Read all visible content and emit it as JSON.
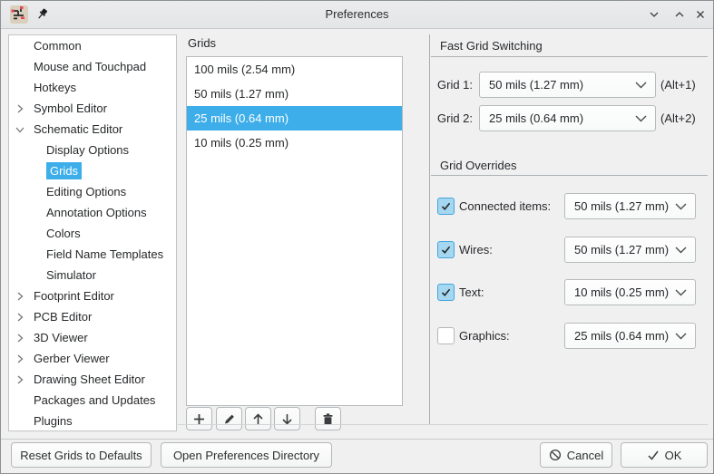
{
  "window": {
    "title": "Preferences",
    "icons": [
      "kicad-app-icon",
      "pin-icon",
      "minimize-icon",
      "maximize-icon",
      "close-icon"
    ]
  },
  "colors": {
    "accent": "#3daee9",
    "selection_text": "#ffffff",
    "panel_bg": "#f0f0f1",
    "sidebar_bg": "#ffffff"
  },
  "sidebar": {
    "items": [
      {
        "label": "Common",
        "level": 0,
        "expander": "none",
        "selected": false
      },
      {
        "label": "Mouse and Touchpad",
        "level": 0,
        "expander": "none",
        "selected": false
      },
      {
        "label": "Hotkeys",
        "level": 0,
        "expander": "none",
        "selected": false
      },
      {
        "label": "Symbol Editor",
        "level": 0,
        "expander": "collapsed",
        "selected": false
      },
      {
        "label": "Schematic Editor",
        "level": 0,
        "expander": "expanded",
        "selected": false
      },
      {
        "label": "Display Options",
        "level": 1,
        "expander": "none",
        "selected": false
      },
      {
        "label": "Grids",
        "level": 1,
        "expander": "none",
        "selected": true
      },
      {
        "label": "Editing Options",
        "level": 1,
        "expander": "none",
        "selected": false
      },
      {
        "label": "Annotation Options",
        "level": 1,
        "expander": "none",
        "selected": false
      },
      {
        "label": "Colors",
        "level": 1,
        "expander": "none",
        "selected": false
      },
      {
        "label": "Field Name Templates",
        "level": 1,
        "expander": "none",
        "selected": false
      },
      {
        "label": "Simulator",
        "level": 1,
        "expander": "none",
        "selected": false
      },
      {
        "label": "Footprint Editor",
        "level": 0,
        "expander": "collapsed",
        "selected": false
      },
      {
        "label": "PCB Editor",
        "level": 0,
        "expander": "collapsed",
        "selected": false
      },
      {
        "label": "3D Viewer",
        "level": 0,
        "expander": "collapsed",
        "selected": false
      },
      {
        "label": "Gerber Viewer",
        "level": 0,
        "expander": "collapsed",
        "selected": false
      },
      {
        "label": "Drawing Sheet Editor",
        "level": 0,
        "expander": "collapsed",
        "selected": false
      },
      {
        "label": "Packages and Updates",
        "level": 0,
        "expander": "none",
        "selected": false
      },
      {
        "label": "Plugins",
        "level": 0,
        "expander": "none",
        "selected": false
      }
    ]
  },
  "grids_panel": {
    "caption": "Grids",
    "items": [
      {
        "label": "100 mils (2.54 mm)",
        "selected": false
      },
      {
        "label": "50 mils (1.27 mm)",
        "selected": false
      },
      {
        "label": "25 mils (0.64 mm)",
        "selected": true
      },
      {
        "label": "10 mils (0.25 mm)",
        "selected": false
      }
    ],
    "toolbar_icons": [
      "add-icon",
      "edit-icon",
      "move-up-icon",
      "move-down-icon",
      "delete-icon"
    ]
  },
  "fast_grid": {
    "heading": "Fast Grid Switching",
    "rows": [
      {
        "label": "Grid 1:",
        "value": "50 mils (1.27 mm)",
        "shortcut": "(Alt+1)"
      },
      {
        "label": "Grid 2:",
        "value": "25 mils (0.64 mm)",
        "shortcut": "(Alt+2)"
      }
    ]
  },
  "grid_overrides": {
    "heading": "Grid Overrides",
    "rows": [
      {
        "label": "Connected items:",
        "checked": true,
        "value": "50 mils (1.27 mm)"
      },
      {
        "label": "Wires:",
        "checked": true,
        "value": "50 mils (1.27 mm)"
      },
      {
        "label": "Text:",
        "checked": true,
        "value": "10 mils (0.25 mm)"
      },
      {
        "label": "Graphics:",
        "checked": false,
        "value": "25 mils (0.64 mm)"
      }
    ]
  },
  "footer": {
    "reset_label": "Reset Grids to Defaults",
    "open_dir_label": "Open Preferences Directory",
    "cancel_label": "Cancel",
    "ok_label": "OK"
  }
}
